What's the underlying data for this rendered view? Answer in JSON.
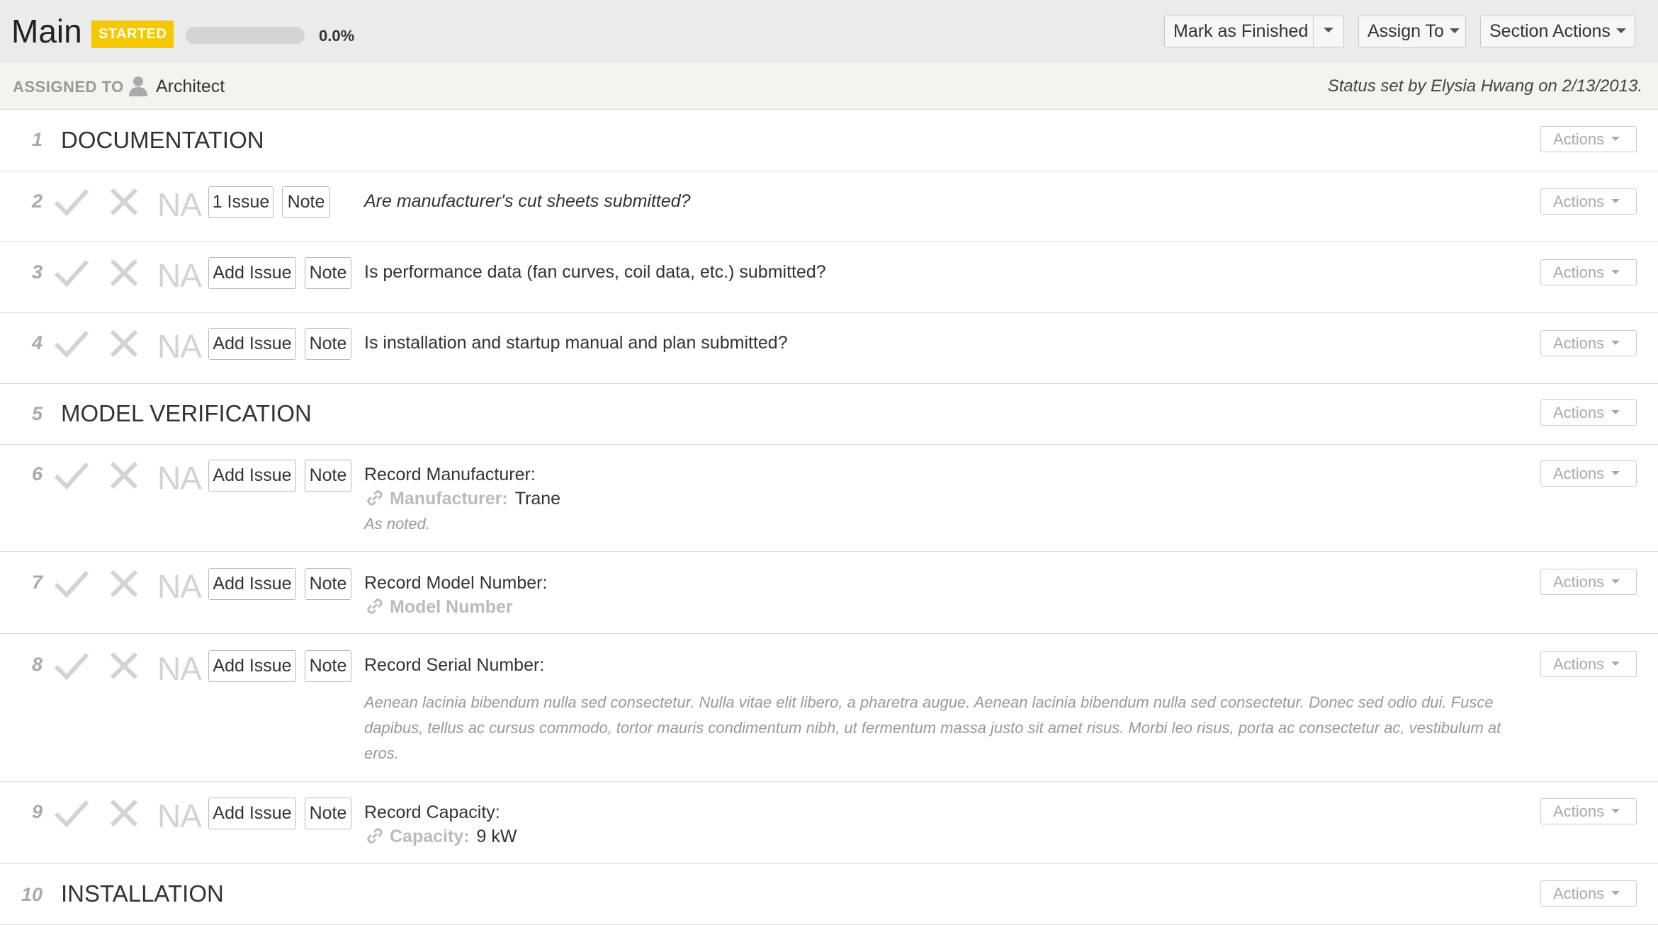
{
  "header": {
    "title": "Main",
    "status_badge": "STARTED",
    "progress_percent": 0.0,
    "progress_label": "0.0%",
    "mark_finished_label": "Mark as Finished",
    "assign_to_label": "Assign To",
    "section_actions_label": "Section Actions"
  },
  "assigned": {
    "label": "ASSIGNED TO",
    "name": "Architect",
    "status_text": "Status set by Elysia Hwang on 2/13/2013."
  },
  "common": {
    "actions_label": "Actions",
    "na_label": "NA",
    "add_issue_label": "Add Issue",
    "note_label": "Note"
  },
  "rows": [
    {
      "number": "1",
      "type": "section",
      "title": "DOCUMENTATION"
    },
    {
      "number": "2",
      "type": "item",
      "issue_label": "1 Issue",
      "question": "Are manufacturer's cut sheets submitted?"
    },
    {
      "number": "3",
      "type": "item",
      "question": "Is performance data (fan curves, coil data, etc.) submitted?"
    },
    {
      "number": "4",
      "type": "item",
      "question": "Is installation and startup manual and plan submitted?"
    },
    {
      "number": "5",
      "type": "section",
      "title": "MODEL VERIFICATION"
    },
    {
      "number": "6",
      "type": "item",
      "question": "Record Manufacturer:",
      "field_label": "Manufacturer:",
      "field_value": "Trane",
      "note": "As noted."
    },
    {
      "number": "7",
      "type": "item",
      "question": "Record Model Number:",
      "field_label": "Model Number"
    },
    {
      "number": "8",
      "type": "item",
      "question": "Record Serial Number:",
      "note": "Aenean lacinia bibendum nulla sed consectetur. Nulla vitae elit libero, a pharetra augue. Aenean lacinia bibendum nulla sed consectetur. Donec sed odio dui. Fusce dapibus, tellus ac cursus commodo, tortor mauris condimentum nibh, ut fermentum massa justo sit amet risus. Morbi leo risus, porta ac consectetur ac, vestibulum at eros."
    },
    {
      "number": "9",
      "type": "item",
      "question": "Record Capacity:",
      "field_label": "Capacity:",
      "field_value": "9 kW"
    },
    {
      "number": "10",
      "type": "section",
      "title": "INSTALLATION"
    }
  ],
  "colors": {
    "badge": "#f5c800",
    "icon_gray": "#d3d3d3"
  },
  "icons": [
    "user-icon",
    "check-icon",
    "cross-icon",
    "link-icon",
    "caret-down-icon"
  ]
}
